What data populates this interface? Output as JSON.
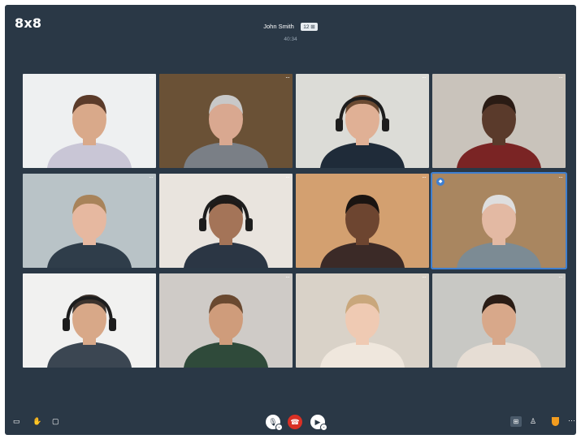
{
  "app": {
    "logo": "8x8"
  },
  "call": {
    "host_name": "John Smith",
    "participant_count": "12",
    "participant_icon": "people-icon",
    "elapsed": "40:34"
  },
  "participants": [
    {
      "bg": "#eef0f1",
      "skin": "#d9a98a",
      "hair": "#5b3b2a",
      "shirt": "#c9c6d6",
      "headset": false
    },
    {
      "bg": "#6a5136",
      "skin": "#d9a890",
      "hair": "#c8c8c8",
      "shirt": "#7a7f86",
      "headset": false
    },
    {
      "bg": "#dcdcd7",
      "skin": "#e0b095",
      "hair": "#6b4a32",
      "shirt": "#1f2b39",
      "headset": true
    },
    {
      "bg": "#c9c3bb",
      "skin": "#5a3a2b",
      "hair": "#2a1b14",
      "shirt": "#7a2424",
      "headset": false
    },
    {
      "bg": "#b9c3c7",
      "skin": "#e6b8a0",
      "hair": "#a8835a",
      "shirt": "#2f3d4a",
      "headset": false
    },
    {
      "bg": "#e9e4de",
      "skin": "#a47458",
      "hair": "#1e1a18",
      "shirt": "#2b3644",
      "headset": true
    },
    {
      "bg": "#d3a070",
      "skin": "#6d4530",
      "hair": "#1a1411",
      "shirt": "#3b2a27",
      "headset": false
    },
    {
      "bg": "#a98660",
      "skin": "#e3b9a3",
      "hair": "#dedede",
      "shirt": "#7c8b94",
      "headset": false,
      "active": true
    },
    {
      "bg": "#f1f1f0",
      "skin": "#d8a888",
      "hair": "#3d332d",
      "shirt": "#3b4652",
      "headset": true
    },
    {
      "bg": "#cfcbc7",
      "skin": "#cf9c7b",
      "hair": "#6a4930",
      "shirt": "#2f4a3a",
      "headset": false
    },
    {
      "bg": "#d9d2c8",
      "skin": "#efcab3",
      "hair": "#c9a77c",
      "shirt": "#efe7dd",
      "headset": false
    },
    {
      "bg": "#c8c8c4",
      "skin": "#d8a88a",
      "hair": "#2a1c15",
      "shirt": "#e6ddd4",
      "headset": false
    }
  ],
  "toolbar": {
    "left": [
      "screen-share-icon",
      "raise-hand-icon",
      "chat-icon"
    ],
    "center": [
      "microphone-icon",
      "end-call-icon",
      "camera-icon"
    ],
    "right": [
      "grid-view-icon",
      "participants-icon",
      "security-shield-icon",
      "more-icon"
    ],
    "colors": {
      "end_call": "#d93025",
      "security": "#f29c1f",
      "active_speaker": "#3f7fd0"
    }
  }
}
